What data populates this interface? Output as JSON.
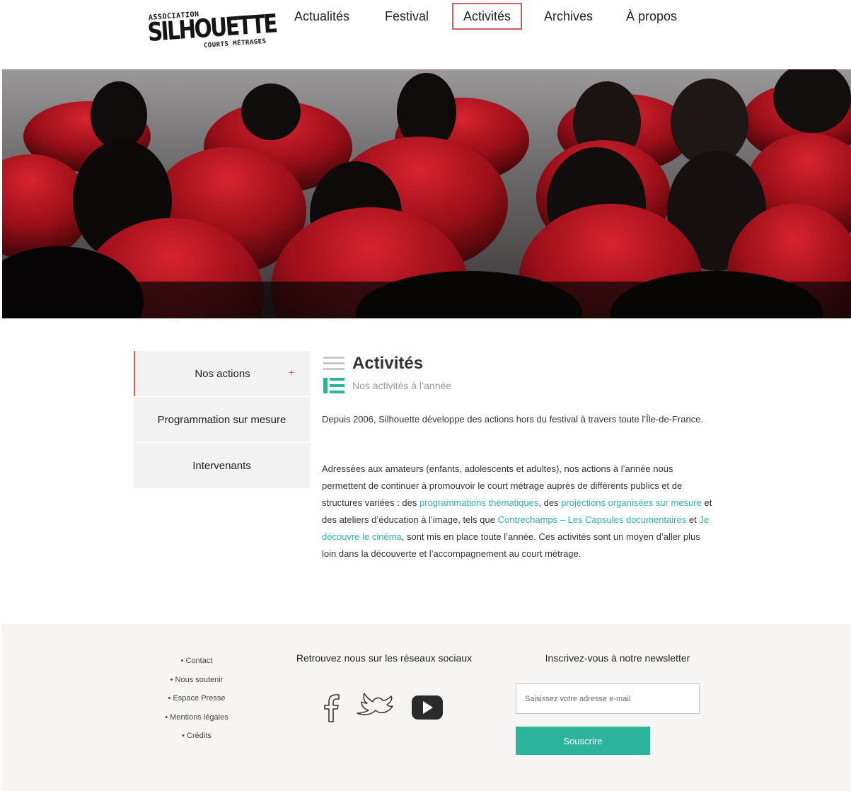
{
  "brand": {
    "logo_top": "ASSOCIATION",
    "logo_main": "SILHOUETTE",
    "logo_sub": "COURTS MÉTRAGES"
  },
  "nav": {
    "items": [
      {
        "label": "Actualités"
      },
      {
        "label": "Festival"
      },
      {
        "label": "Activités",
        "active": true
      },
      {
        "label": "Archives"
      },
      {
        "label": "À propos"
      }
    ]
  },
  "hero": {
    "icon": "cinema-audience-photo"
  },
  "side_menu": {
    "items": [
      {
        "label": "Nos actions",
        "active": true,
        "marker": "+"
      },
      {
        "label": "Programmation sur mesure"
      },
      {
        "label": "Intervenants"
      }
    ]
  },
  "content": {
    "title": "Activités",
    "subtitle": "Nos activités à l’année",
    "para1": "Depuis 2006, Silhouette développe des actions hors du festival à travers toute l’Île-de-France.",
    "para2": {
      "t1": "Adressées aux amateurs (enfants, adolescents et adultes), nos actions à l’année nous permettent de continuer à promouvoir le court métrage auprès de différents publics et de structures variées : des ",
      "link1": "programmations thématiques",
      "t2": ", des ",
      "link2": "projections organisées sur mesure",
      "t3": " et des ateliers d’éducation à l’image, tels que ",
      "link3": "Contrechamps – Les Capsules documentaires",
      "t4": " et ",
      "link4": "Je découvre le cinéma",
      "t5": ", sont mis en place toute l’année. Ces activités sont un moyen d’aller plus loin dans la découverte et l’accompagnement au court métrage."
    }
  },
  "footer": {
    "links": [
      "Contact",
      "Nous soutenir",
      "Espace Presse",
      "Mentions légales",
      "Crédits"
    ],
    "social_title": "Retrouvez nous sur les réseaux sociaux",
    "social": [
      "facebook-icon",
      "twitter-icon",
      "youtube-icon"
    ],
    "newsletter_title": "Inscrivez-vous à notre newsletter",
    "newsletter_placeholder": "Saisissez votre adresse e-mail",
    "newsletter_button": "Souscrire"
  },
  "colors": {
    "accent_red": "#e05a5a",
    "accent_green": "#2cb39c",
    "seat_red": "#b3141f"
  }
}
